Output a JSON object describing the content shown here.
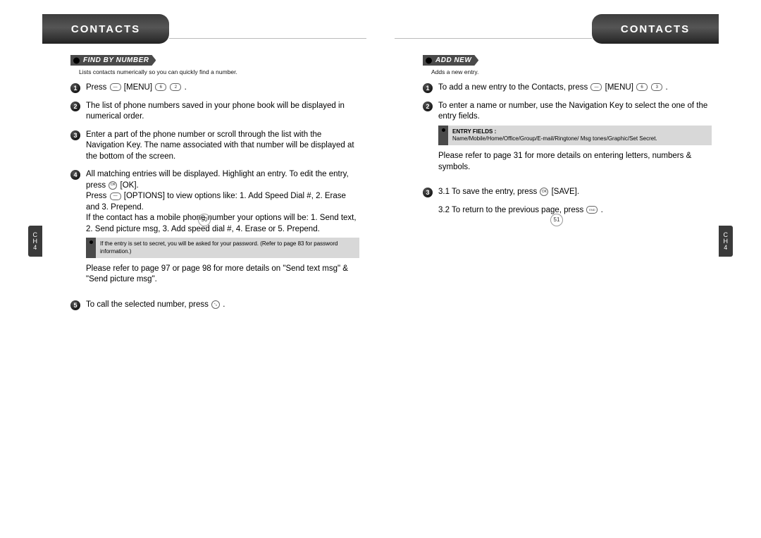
{
  "left": {
    "header": "CONTACTS",
    "section_title": "FIND BY NUMBER",
    "intro": "Lists contacts numerically so you can quickly find a number.",
    "side_tab": [
      "C",
      "H",
      "4"
    ],
    "page_number": "50",
    "steps": {
      "1": {
        "pre": "Press ",
        "after_menu": " [MENU] ",
        "end": " ."
      },
      "2": "The list of phone numbers saved in your phone book will be displayed in numerical order.",
      "3": "Enter a part of the phone number or scroll through the list with the Navigation Key. The name associated with that number will be displayed at the bottom of the screen.",
      "4": {
        "line1_a": "All matching entries will be displayed. Highlight an entry. To edit the entry, press ",
        "line1_b": " [OK].",
        "line2_a": "Press ",
        "line2_b": " [OPTIONS] to view options like: 1. Add Speed Dial #, 2. Erase and 3. Prepend.",
        "line3": "If the contact has a mobile phone number your options will be: 1. Send text, 2. Send picture msg, 3. Add speed dial #, 4. Erase or 5. Prepend."
      },
      "note": "If the entry is set to secret, you will be asked for your password. (Refer to page 83 for password information.)",
      "ref": "Please refer to page 97 or page 98 for more details on \"Send text msg\" & \"Send picture msg\".",
      "5": {
        "a": "To call the selected number, press ",
        "b": " ."
      }
    }
  },
  "right": {
    "header": "CONTACTS",
    "section_title": "ADD NEW",
    "intro": "Adds a new entry.",
    "side_tab": [
      "C",
      "H",
      "4"
    ],
    "page_number": "51",
    "steps": {
      "1": {
        "a": "To add a new entry to the Contacts, press ",
        "b": " [MENU] ",
        "c": " ."
      },
      "2": "To enter a name or number, use the Navigation Key to select the one of the entry fields.",
      "note_title": "ENTRY FIELDS :",
      "note_body": "Name/Mobile/Home/Office/Group/E-mail/Ringtone/ Msg tones/Graphic/Set Secret.",
      "ref": "Please refer to page 31 for more details on entering letters, numbers & symbols.",
      "3a": {
        "a": "3.1 To save the entry, press ",
        "b": " [SAVE]."
      },
      "3b": {
        "a": "3.2 To return to the previous page, press ",
        "b": " ."
      }
    }
  }
}
